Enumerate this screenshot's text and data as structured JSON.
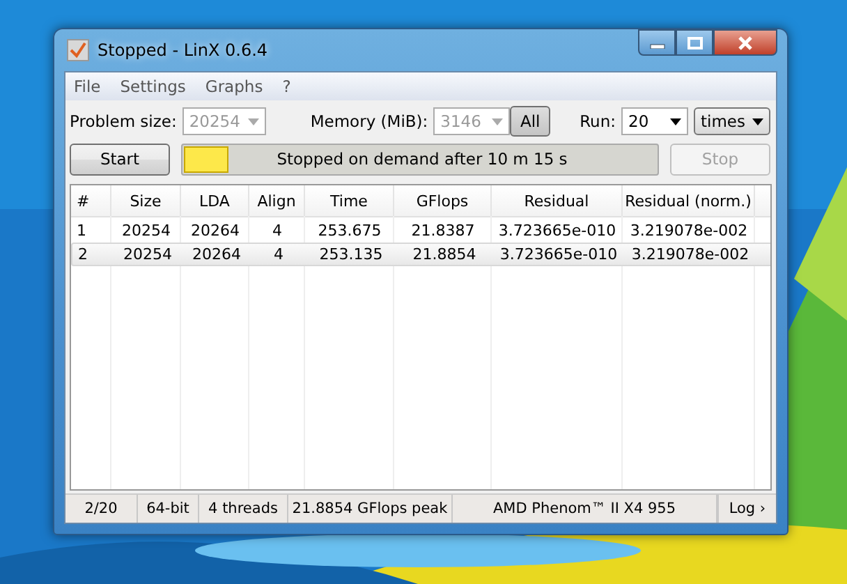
{
  "window": {
    "title": "Stopped - LinX 0.6.4"
  },
  "menu": [
    "File",
    "Settings",
    "Graphs",
    "?"
  ],
  "problem_size": {
    "label": "Problem size:",
    "value": "20254",
    "disabled": true
  },
  "memory": {
    "label": "Memory (MiB):",
    "value": "3146",
    "disabled": true,
    "all_button": "All"
  },
  "run": {
    "label": "Run:",
    "value": "20",
    "unit": "times"
  },
  "start_button": {
    "label": "Start",
    "disabled": false
  },
  "status_text": "Stopped on demand after  10 m 15 s",
  "stop_button": {
    "label": "Stop",
    "disabled": true
  },
  "table": {
    "columns": [
      "#",
      "Size",
      "LDA",
      "Align",
      "Time",
      "GFlops",
      "Residual",
      "Residual (norm.)"
    ],
    "rows": [
      {
        "cells": [
          "1",
          "20254",
          "20264",
          "4",
          "253.675",
          "21.8387",
          "3.723665e-010",
          "3.219078e-002"
        ],
        "selected": false
      },
      {
        "cells": [
          "2",
          "20254",
          "20264",
          "4",
          "253.135",
          "21.8854",
          "3.723665e-010",
          "3.219078e-002"
        ],
        "selected": true
      }
    ]
  },
  "status_bar": [
    "2/20",
    "64-bit",
    "4 threads",
    "21.8854 GFlops peak",
    "AMD Phenom™ II X4 955"
  ],
  "log_button": "Log ›"
}
